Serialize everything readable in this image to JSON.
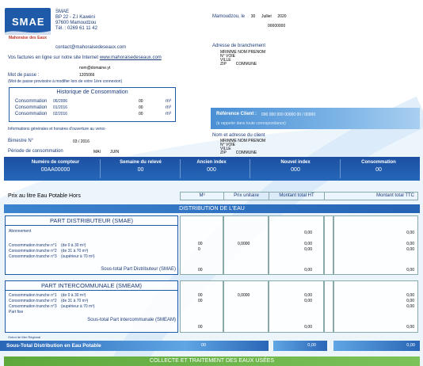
{
  "logo": {
    "text": "SMAE",
    "caption": "Mahoraise des Eaux"
  },
  "company": {
    "name": "SMAE",
    "address1": "BP 22 - Z.I Kawéni",
    "address2": "97600 Mamoudzou",
    "phone": "Tél. : 0269 61 11 42",
    "email": "contact@mahoraisedeseaux.com"
  },
  "online": {
    "text": "Vos factures en ligne sur notre site Internet",
    "url": "www.mahoraisedeseaux.com",
    "user": "nom@domaine.yt",
    "pwd_label": "Mot de passe :",
    "pwd_value": "1205066",
    "pwd_note": "(Mot de passe provisoire à modifier lors de votre 1ère connexion)"
  },
  "date": {
    "city": "Mamoudzou, le",
    "day": "30",
    "month": "Juillet",
    "year": "2020",
    "number": "00000000"
  },
  "branchement": {
    "title": "Adresse de branchement",
    "l1": "MR/MME NOM PRENOM",
    "l2": "N° VOIE",
    "l3": "VILLE",
    "zip": "ZIP",
    "commune": "COMMUNE"
  },
  "history": {
    "title": "Historique de Consommation",
    "rows": [
      {
        "label": "Consommation",
        "date": "06/2006",
        "val": "00",
        "unit": "m³"
      },
      {
        "label": "Consommation",
        "date": "01/2016",
        "val": "00",
        "unit": "m³"
      },
      {
        "label": "Consommation",
        "date": "02/2016",
        "val": "00",
        "unit": "m³"
      }
    ]
  },
  "reference": {
    "label": "Référence Client :",
    "value": "000 000 000 00000 00 / 00000",
    "note": "(à rappeler dans toute correspondance)"
  },
  "client": {
    "title": "Nom et adresse du client",
    "l1": "MR/MME NOM PRENOM",
    "l2": "N° VOIE",
    "l3": "VILLE",
    "zip": "ZIP",
    "commune": "COMMUNE"
  },
  "info": "Informations générales et horaires d'ouverture au verso",
  "bimestre": {
    "label": "Bimestre N°",
    "value": "03 / 2016"
  },
  "periode": {
    "label": "Période de consommation",
    "from": "MAI",
    "to": "JUIN"
  },
  "meter": {
    "cols": [
      {
        "h": "Numéro de compteur",
        "v": "00AA00000"
      },
      {
        "h": "Semaine du relevé",
        "v": "00"
      },
      {
        "h": "Ancien index",
        "v": "000"
      },
      {
        "h": "Nouvel index",
        "v": "000"
      },
      {
        "h": "Consommation",
        "v": "00"
      }
    ]
  },
  "price": {
    "title": "Prix au litre Eau Potable Hors",
    "headers": [
      "M³",
      "Prix unitaire",
      "Montant total HT",
      "Montant total TTC"
    ]
  },
  "distribution": {
    "title": "DISTRIBUTION DE L'EAU"
  },
  "smae_part": {
    "title": "PART DISTRIBUTEUR (SMAE)",
    "abonnement": "Abonnement",
    "tranches": [
      {
        "label": "Consommation tranche n°1",
        "range": "(de 0 à 30 m³)"
      },
      {
        "label": "Consommation tranche n°2",
        "range": "(de 31 à 70 m³)"
      },
      {
        "label": "Consommation tranche n°3",
        "range": "(supérieur à 70 m³)"
      }
    ],
    "subtotal": "Sous-total Part Distributeur (SMAE)",
    "m3": [
      "00",
      "0"
    ],
    "unit_price": "0,0000",
    "ht": [
      "0,00",
      "0,00",
      "0,00"
    ],
    "ttc": [
      "0,00",
      "0,00",
      "0,00"
    ],
    "sub_m3": "00",
    "sub_ht": "0,00",
    "sub_ttc": "0,00"
  },
  "smeam_part": {
    "title": "PART INTERCOMMUNALE (SMEAM)",
    "tranches": [
      {
        "label": "Consommation tranche n°1",
        "range": "(de 0 à 30 m³)"
      },
      {
        "label": "Consommation tranche n°2",
        "range": "(de 31 à 70 m³)"
      },
      {
        "label": "Consommation tranche n°3",
        "range": "(supérieur à 70 m³)"
      }
    ],
    "fixe": "Part fixe",
    "subtotal": "Sous-total Part intercommunale (SMEAM)",
    "m3": [
      "00",
      "00"
    ],
    "unit_price": "0,0000",
    "ht": [
      "0,00",
      "0,00"
    ],
    "ttc": [
      "0,00",
      "0,00",
      "0,00"
    ],
    "sub_m3": "00",
    "sub_ht": "0,00",
    "sub_ttc": "0,00"
  },
  "octroi": "Octroi de Mer Régional",
  "total_distribution": {
    "label": "Sous-Total Distribution en Eau Potable",
    "m3": "00",
    "ht": "0,00",
    "ttc": "0,00"
  },
  "collecte": {
    "title": "COLLECTE ET TRAITEMENT DES EAUX USÉES"
  },
  "colors": {
    "brand": "#1e5aa8",
    "accent": "#5ea83c",
    "text": "#1a3a78"
  }
}
